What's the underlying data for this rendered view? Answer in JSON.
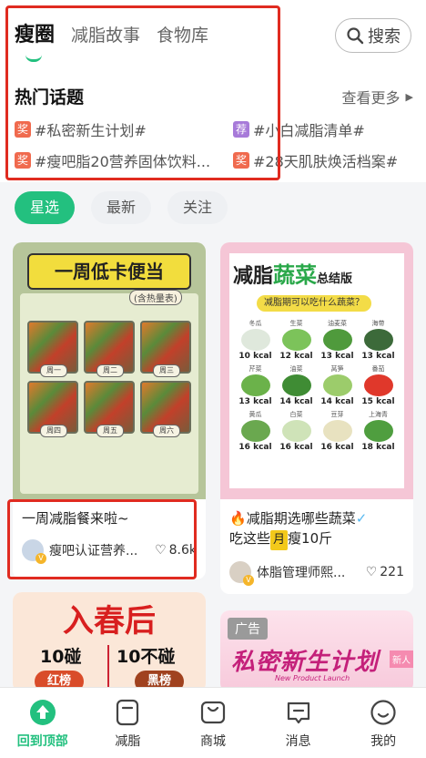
{
  "header": {
    "tabs": [
      {
        "label": "瘦圈",
        "active": true
      },
      {
        "label": "减脂故事",
        "active": false
      },
      {
        "label": "食物库",
        "active": false
      }
    ],
    "search_label": "搜索"
  },
  "hot": {
    "title": "热门话题",
    "see_more": "查看更多",
    "topics": [
      {
        "badge": "奖",
        "badge_color": "#f06a4e",
        "text": "#私密新生计划#"
      },
      {
        "badge": "荐",
        "badge_color": "#a77ad9",
        "text": "#小白减脂清单#"
      },
      {
        "badge": "奖",
        "badge_color": "#f06a4e",
        "text": "#瘦吧脂20营养固体饮料..."
      },
      {
        "badge": "奖",
        "badge_color": "#f06a4e",
        "text": "#28天肌肤焕活档案#"
      }
    ]
  },
  "filters": [
    {
      "label": "星选",
      "active": true
    },
    {
      "label": "最新",
      "active": false
    },
    {
      "label": "关注",
      "active": false
    }
  ],
  "feed": {
    "card1": {
      "cover_banner": "一周低卡便当",
      "cover_sub": "(含热量表)",
      "days": [
        "周一",
        "周二",
        "周三",
        "周四",
        "周五",
        "周六"
      ],
      "title": "一周减脂餐来啦~",
      "author": "瘦吧认证营养...",
      "likes": "8.6k"
    },
    "card2": {
      "cover_head_1": "减脂",
      "cover_head_2": "蔬菜",
      "cover_head_3": "总结版",
      "cover_question": "减脂期可以吃什么蔬菜？",
      "veggies": [
        {
          "name": "冬瓜",
          "kcal": "10 kcal",
          "color": "#dfe8dc"
        },
        {
          "name": "生菜",
          "kcal": "12 kcal",
          "color": "#7cc35a"
        },
        {
          "name": "油麦菜",
          "kcal": "13 kcal",
          "color": "#4f9a3c"
        },
        {
          "name": "海带",
          "kcal": "13 kcal",
          "color": "#3c6a3a"
        },
        {
          "name": "芹菜",
          "kcal": "13 kcal",
          "color": "#6bb24a"
        },
        {
          "name": "油菜",
          "kcal": "14 kcal",
          "color": "#3f8c34"
        },
        {
          "name": "莴笋",
          "kcal": "14 kcal",
          "color": "#9ccc6b"
        },
        {
          "name": "番茄",
          "kcal": "15 kcal",
          "color": "#e0382b"
        },
        {
          "name": "黄瓜",
          "kcal": "16 kcal",
          "color": "#6aa84f"
        },
        {
          "name": "白菜",
          "kcal": "16 kcal",
          "color": "#cfe3b8"
        },
        {
          "name": "豆芽",
          "kcal": "16 kcal",
          "color": "#e8e2c0"
        },
        {
          "name": "上海青",
          "kcal": "18 kcal",
          "color": "#4f9e3f"
        }
      ],
      "title_fire": "🔥",
      "title_text": "减脂期选哪些蔬菜",
      "title_check": "✓",
      "title_line2_a": "吃这些",
      "title_tag": "月",
      "title_line2_b": "瘦10斤",
      "author": "体脂管理师熙...",
      "likes": "221"
    },
    "card3": {
      "cover_title": "入春后",
      "left": "10碰",
      "right": "10不碰",
      "btn_left": "红榜",
      "btn_right": "黑榜"
    },
    "card4": {
      "ad_label": "广告",
      "cover_title": "私密新生计划",
      "cover_en": "New Product Launch",
      "new_tag": "新人"
    }
  },
  "bottom_nav": [
    {
      "label": "回到顶部",
      "icon": "back-to-top-icon",
      "active": true
    },
    {
      "label": "减脂",
      "icon": "fat-loss-icon",
      "active": false
    },
    {
      "label": "商城",
      "icon": "shop-icon",
      "active": false
    },
    {
      "label": "消息",
      "icon": "message-icon",
      "active": false
    },
    {
      "label": "我的",
      "icon": "profile-icon",
      "active": false
    }
  ],
  "colors": {
    "accent": "#23c07f",
    "highlight": "#e02b20"
  }
}
